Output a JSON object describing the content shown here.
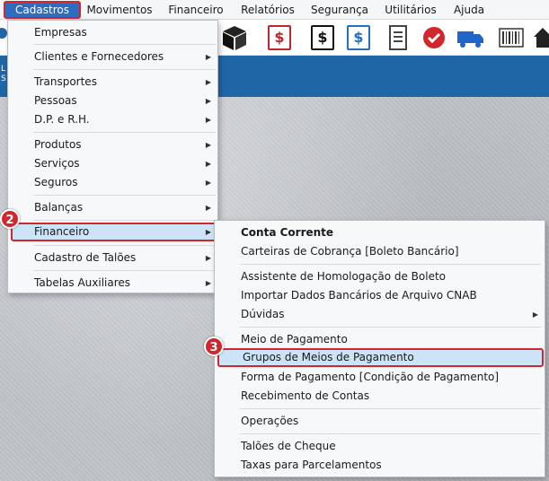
{
  "menubar": {
    "items": [
      {
        "label": "Cadastros"
      },
      {
        "label": "Movimentos"
      },
      {
        "label": "Financeiro"
      },
      {
        "label": "Relatórios"
      },
      {
        "label": "Segurança"
      },
      {
        "label": "Utilitários"
      },
      {
        "label": "Ajuda"
      }
    ]
  },
  "toolbar": {
    "icons": [
      "box-icon",
      "dollar-red-icon",
      "dollar-black-icon",
      "dollar-blue-icon",
      "document-icon",
      "check-circle-icon",
      "truck-icon",
      "barcode-icon",
      "home-icon"
    ],
    "dollar_glyph": "$"
  },
  "blueband": {
    "left_text_1": "L",
    "left_text_2": "S"
  },
  "cadastros_menu": {
    "items": [
      {
        "label": "Empresas"
      },
      {
        "label": "Clientes e Fornecedores"
      },
      {
        "label": "Transportes"
      },
      {
        "label": "Pessoas"
      },
      {
        "label": "D.P. e R.H."
      },
      {
        "label": "Produtos"
      },
      {
        "label": "Serviços"
      },
      {
        "label": "Seguros"
      },
      {
        "label": "Balanças"
      },
      {
        "label": "Financeiro"
      },
      {
        "label": "Cadastro de Talões"
      },
      {
        "label": "Tabelas Auxiliares"
      }
    ]
  },
  "financeiro_menu": {
    "items": [
      {
        "label": "Conta Corrente"
      },
      {
        "label": "Carteiras de Cobrança [Boleto Bancário]"
      },
      {
        "label": "Assistente de Homologação de Boleto"
      },
      {
        "label": "Importar Dados Bancários de Arquivo CNAB"
      },
      {
        "label": "Dúvidas"
      },
      {
        "label": "Meio de Pagamento"
      },
      {
        "label": "Grupos de Meios de Pagamento"
      },
      {
        "label": "Forma de Pagamento [Condição de Pagamento]"
      },
      {
        "label": "Recebimento de Contas"
      },
      {
        "label": "Operações"
      },
      {
        "label": "Talões de Cheque"
      },
      {
        "label": "Taxas para Parcelamentos"
      }
    ]
  },
  "badges": {
    "step2": "2",
    "step3": "3"
  },
  "colors": {
    "accent_blue": "#2d6cc0",
    "highlight_red": "#d0262c",
    "band_blue": "#1f66a6"
  }
}
